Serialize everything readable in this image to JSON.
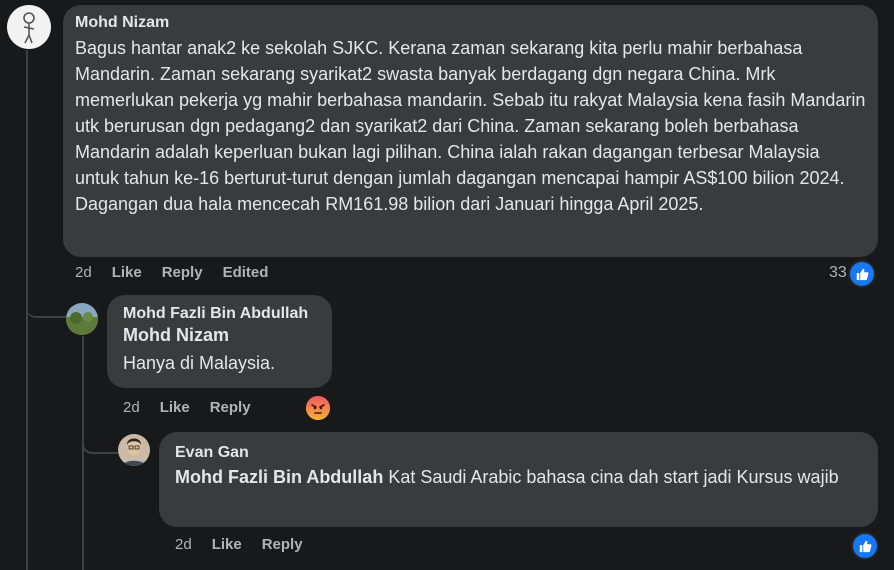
{
  "comment1": {
    "author": "Mohd Nizam",
    "text": "Bagus hantar anak2 ke sekolah SJKC. Kerana zaman sekarang kita perlu mahir berbahasa Mandarin. Zaman sekarang syarikat2 swasta banyak berdagang dgn negara China. Mrk memerlukan pekerja yg mahir berbahasa mandarin. Sebab itu rakyat Malaysia kena fasih Mandarin utk berurusan dgn pedagang2 dan syarikat2 dari China. Zaman sekarang boleh berbahasa Mandarin adalah keperluan bukan lagi pilihan. China ialah rakan dagangan terbesar Malaysia untuk tahun ke-16 berturut-turut dengan jumlah dagangan mencapai hampir AS$100 bilion 2024. Dagangan dua hala mencecah RM161.98 bilion dari Januari hingga April 2025.",
    "time": "2d",
    "like_label": "Like",
    "reply_label": "Reply",
    "edited_label": "Edited",
    "reaction_count": "33",
    "reaction_icon": "like-icon"
  },
  "comment2": {
    "author": "Mohd Fazli Bin Abdullah",
    "mention": "Mohd Nizam",
    "text": "Hanya di Malaysia.",
    "time": "2d",
    "like_label": "Like",
    "reply_label": "Reply",
    "reaction_icon": "angry-icon"
  },
  "comment3": {
    "author": "Evan Gan",
    "mention": "Mohd Fazli Bin Abdullah",
    "text": " Kat Saudi Arabic bahasa cina dah start jadi Kursus wajib",
    "time": "2d",
    "like_label": "Like",
    "reply_label": "Reply",
    "reaction_icon": "like-icon"
  },
  "colors": {
    "background": "#18191a",
    "bubble": "#3a3b3c",
    "like_blue": "#1877f2",
    "angry_orange": "#e9710f",
    "secondary_text": "#b0b3b8"
  }
}
